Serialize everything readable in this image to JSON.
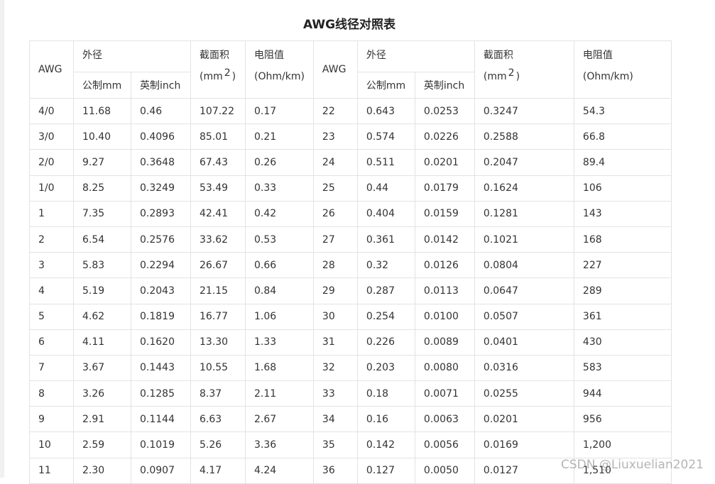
{
  "title": "AWG线径对照表",
  "header": {
    "awg": "AWG",
    "outer_diameter": "外径",
    "metric_mm": "公制mm",
    "imperial_inch": "英制inch",
    "area_line1": "截面积",
    "area_unit_pre": "(mm",
    "area_unit_sup": "2",
    "area_unit_post": ")",
    "resistance_line1": "电阻值",
    "resistance_line2": "(Ohm/km)"
  },
  "rows": [
    {
      "left": [
        "4/0",
        "11.68",
        "0.46",
        "107.22",
        "0.17"
      ],
      "right": [
        "22",
        "0.643",
        "0.0253",
        "0.3247",
        "54.3"
      ]
    },
    {
      "left": [
        "3/0",
        "10.40",
        "0.4096",
        "85.01",
        "0.21"
      ],
      "right": [
        "23",
        "0.574",
        "0.0226",
        "0.2588",
        "66.8"
      ]
    },
    {
      "left": [
        "2/0",
        "9.27",
        "0.3648",
        "67.43",
        "0.26"
      ],
      "right": [
        "24",
        "0.511",
        "0.0201",
        "0.2047",
        "89.4"
      ]
    },
    {
      "left": [
        "1/0",
        "8.25",
        "0.3249",
        "53.49",
        "0.33"
      ],
      "right": [
        "25",
        "0.44",
        "0.0179",
        "0.1624",
        "106"
      ]
    },
    {
      "left": [
        "1",
        "7.35",
        "0.2893",
        "42.41",
        "0.42"
      ],
      "right": [
        "26",
        "0.404",
        "0.0159",
        "0.1281",
        "143"
      ]
    },
    {
      "left": [
        "2",
        "6.54",
        "0.2576",
        "33.62",
        "0.53"
      ],
      "right": [
        "27",
        "0.361",
        "0.0142",
        "0.1021",
        "168"
      ]
    },
    {
      "left": [
        "3",
        "5.83",
        "0.2294",
        "26.67",
        "0.66"
      ],
      "right": [
        "28",
        "0.32",
        "0.0126",
        "0.0804",
        "227"
      ]
    },
    {
      "left": [
        "4",
        "5.19",
        "0.2043",
        "21.15",
        "0.84"
      ],
      "right": [
        "29",
        "0.287",
        "0.0113",
        "0.0647",
        "289"
      ]
    },
    {
      "left": [
        "5",
        "4.62",
        "0.1819",
        "16.77",
        "1.06"
      ],
      "right": [
        "30",
        "0.254",
        "0.0100",
        "0.0507",
        "361"
      ]
    },
    {
      "left": [
        "6",
        "4.11",
        "0.1620",
        "13.30",
        "1.33"
      ],
      "right": [
        "31",
        "0.226",
        "0.0089",
        "0.0401",
        "430"
      ]
    },
    {
      "left": [
        "7",
        "3.67",
        "0.1443",
        "10.55",
        "1.68"
      ],
      "right": [
        "32",
        "0.203",
        "0.0080",
        "0.0316",
        "583"
      ]
    },
    {
      "left": [
        "8",
        "3.26",
        "0.1285",
        "8.37",
        "2.11"
      ],
      "right": [
        "33",
        "0.18",
        "0.0071",
        "0.0255",
        "944"
      ]
    },
    {
      "left": [
        "9",
        "2.91",
        "0.1144",
        "6.63",
        "2.67"
      ],
      "right": [
        "34",
        "0.16",
        "0.0063",
        "0.0201",
        "956"
      ]
    },
    {
      "left": [
        "10",
        "2.59",
        "0.1019",
        "5.26",
        "3.36"
      ],
      "right": [
        "35",
        "0.142",
        "0.0056",
        "0.0169",
        "1,200"
      ]
    },
    {
      "left": [
        "11",
        "2.30",
        "0.0907",
        "4.17",
        "4.24"
      ],
      "right": [
        "36",
        "0.127",
        "0.0050",
        "0.0127",
        "1,510"
      ]
    }
  ],
  "watermark": "CSDN @Liuxuelian2021"
}
